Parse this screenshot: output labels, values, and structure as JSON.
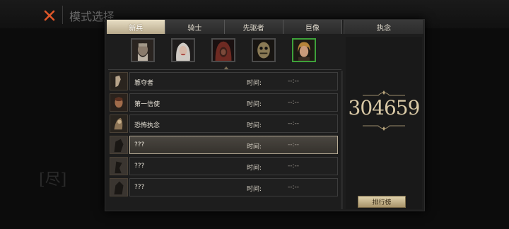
{
  "background": {
    "title": "模式选择",
    "bottom_text": "[尽]",
    "close_icon_color": "#e0582a"
  },
  "tabs": [
    {
      "label": "新兵",
      "active": true
    },
    {
      "label": "骑士",
      "active": false
    },
    {
      "label": "先驱者",
      "active": false
    },
    {
      "label": "巨像",
      "active": false
    }
  ],
  "panel_header": "执念",
  "portraits": [
    {
      "name": "old-warrior-portrait",
      "selected": false
    },
    {
      "name": "white-haired-woman-portrait",
      "selected": false
    },
    {
      "name": "hooded-figure-portrait",
      "selected": false
    },
    {
      "name": "masked-figure-portrait",
      "selected": false
    },
    {
      "name": "blonde-man-portrait",
      "selected": true
    }
  ],
  "rows": [
    {
      "name": "篡夺者",
      "time_label": "时间:",
      "time_value": "--:--",
      "selected": false
    },
    {
      "name": "第一信使",
      "time_label": "时间:",
      "time_value": "--:--",
      "selected": false
    },
    {
      "name": "恐怖执念",
      "time_label": "时间:",
      "time_value": "--:--",
      "selected": false
    },
    {
      "name": "???",
      "time_label": "时间:",
      "time_value": "--:--",
      "selected": true
    },
    {
      "name": "???",
      "time_label": "时间:",
      "time_value": "--:--",
      "selected": false
    },
    {
      "name": "???",
      "time_label": "时间:",
      "time_value": "--:--",
      "selected": false
    }
  ],
  "score": "304659",
  "rank_button": "排行榜",
  "colors": {
    "accent_gold": "#d9c9a6",
    "selected_portrait_border": "#3ea13a"
  }
}
